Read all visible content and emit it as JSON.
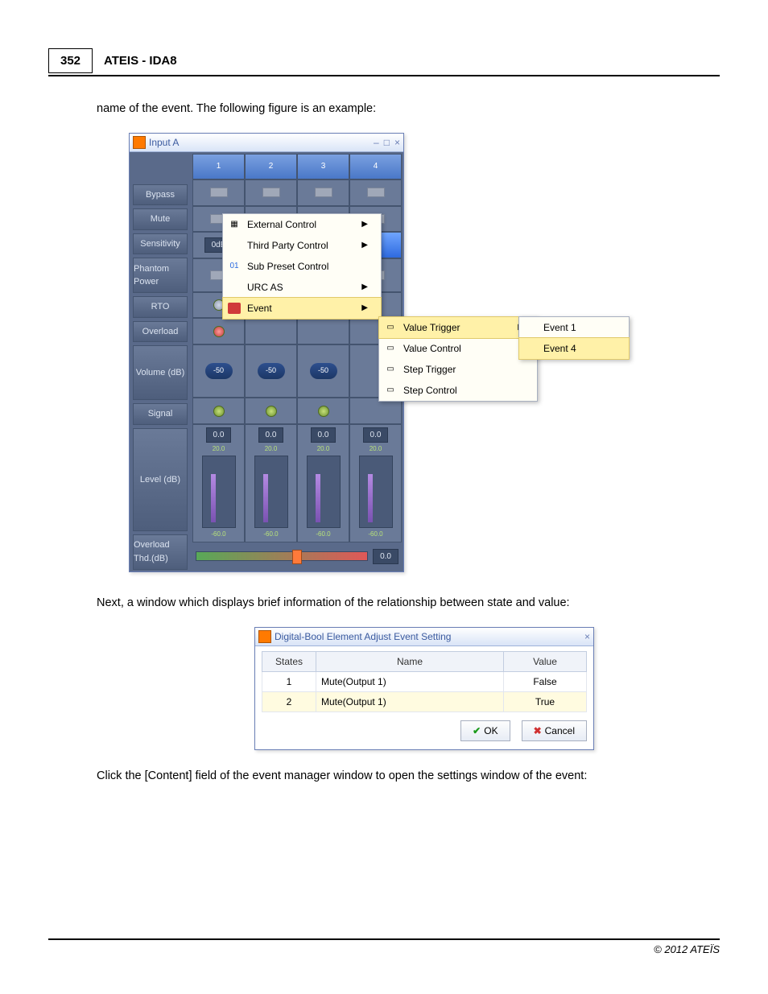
{
  "header": {
    "page_number": "352",
    "title": "ATEIS - IDA8"
  },
  "para_intro": "name of the event. The following figure is an example:",
  "para_mid": "Next, a window which displays brief information of the relationship between state and value:",
  "para_end": "Click the [Content] field of the event manager window to open the settings window of the event:",
  "footer": "© 2012 ATEÏS",
  "inputA": {
    "title": "Input A",
    "cols": [
      "1",
      "2",
      "3",
      "4"
    ],
    "rows": {
      "bypass": "Bypass",
      "mute": "Mute",
      "sensitivity": "Sensitivity",
      "sens_val": "0dB",
      "phantom": "Phantom Power",
      "rto": "RTO",
      "overload": "Overload",
      "volume": "Volume (dB)",
      "vol_val": "-50",
      "signal": "Signal",
      "level": "Level (dB)",
      "lvl_top": "0.0",
      "lvl_hi": "20.0",
      "lvl_lo": "-60.0",
      "overload_thd": "Overload Thd.(dB)",
      "thd_val": "0.0"
    }
  },
  "ctx_main": {
    "items": [
      {
        "label": "External Control",
        "arrow": true
      },
      {
        "label": "Third Party Control",
        "arrow": true
      },
      {
        "label": "Sub Preset Control",
        "arrow": false
      },
      {
        "label": "URC AS",
        "arrow": true
      },
      {
        "label": "Event",
        "arrow": true,
        "hl": true
      }
    ]
  },
  "ctx_event": {
    "items": [
      {
        "label": "Value Trigger",
        "arrow": true,
        "hl": true
      },
      {
        "label": "Value Control",
        "arrow": false
      },
      {
        "label": "Step Trigger",
        "arrow": false
      },
      {
        "label": "Step Control",
        "arrow": false
      }
    ]
  },
  "ctx_evtnum": {
    "items": [
      {
        "label": "Event 1"
      },
      {
        "label": "Event 4",
        "hl": true
      }
    ]
  },
  "dialog": {
    "title": "Digital-Bool Element Adjust Event Setting",
    "headers": {
      "states": "States",
      "name": "Name",
      "value": "Value"
    },
    "rows": [
      {
        "state": "1",
        "name": "Mute(Output 1)",
        "value": "False"
      },
      {
        "state": "2",
        "name": "Mute(Output 1)",
        "value": "True"
      }
    ],
    "ok": "OK",
    "cancel": "Cancel"
  }
}
